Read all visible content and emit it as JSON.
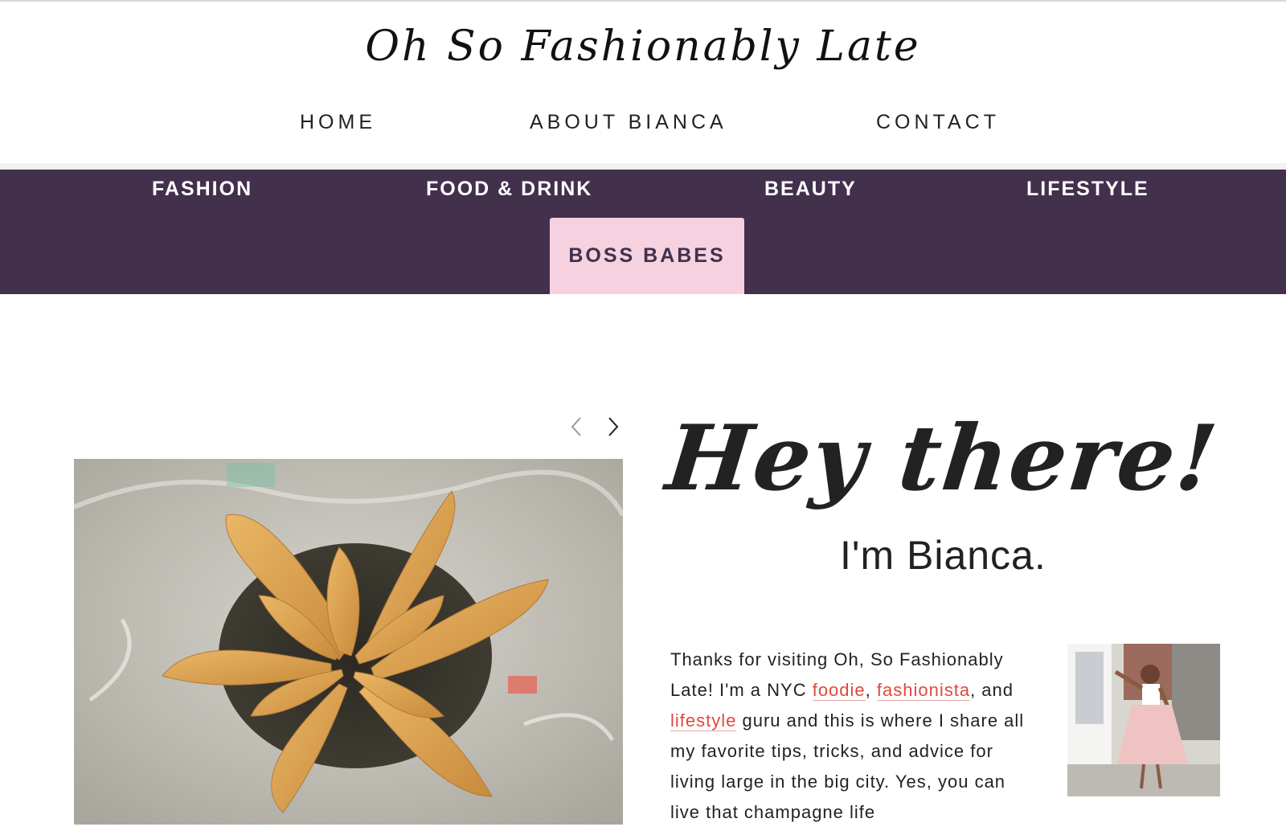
{
  "brand": {
    "title": "Oh So Fashionably Late"
  },
  "top_nav": {
    "items": [
      {
        "label": "HOME"
      },
      {
        "label": "ABOUT BIANCA"
      },
      {
        "label": "CONTACT"
      }
    ]
  },
  "category_nav": {
    "items": [
      {
        "label": "FASHION"
      },
      {
        "label": "FOOD & DRINK"
      },
      {
        "label": "BEAUTY"
      },
      {
        "label": "LIFESTYLE"
      }
    ],
    "active": {
      "label": "BOSS BABES"
    }
  },
  "colors": {
    "category_bar": "#42304d",
    "active_tab": "#f6d1df",
    "link": "#e2473f"
  },
  "slider": {
    "prev_icon": "chevron-left-icon",
    "next_icon": "chevron-right-icon"
  },
  "intro": {
    "greeting": "Hey there!",
    "name_line": "I'm Bianca.",
    "bio_part1": "Thanks for visiting Oh, So Fashionably Late! I'm a NYC ",
    "link_foodie": "foodie",
    "sep_comma": ", ",
    "link_fashionista": "fashionista",
    "bio_part2": ", and ",
    "link_lifestyle": "lifestyle",
    "bio_part3": " guru and this is where I share all my favorite tips, tricks, and advice for living large in the big city. Yes, you can live that champagne life"
  }
}
